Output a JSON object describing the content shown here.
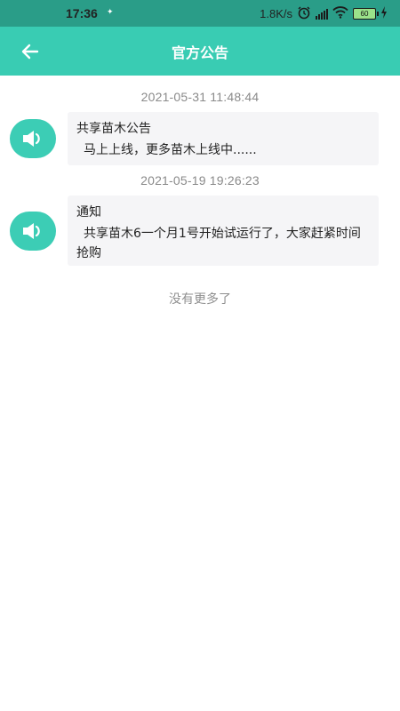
{
  "status_bar": {
    "time": "17:36",
    "network_speed": "1.8K/s",
    "battery_level": "60"
  },
  "header": {
    "title": "官方公告",
    "back_icon": "back-arrow-icon"
  },
  "notices": [
    {
      "timestamp": "2021-05-31 11:48:44",
      "title": "共享苗木公告",
      "body": "马上上线，更多苗木上线中......",
      "icon": "speaker-icon"
    },
    {
      "timestamp": "2021-05-19 19:26:23",
      "title": "通知",
      "body": "共享苗木6一个月1号开始试运行了，大家赶紧时间抢购",
      "icon": "speaker-icon"
    }
  ],
  "footer_text": "没有更多了",
  "colors": {
    "header_bg": "#39ccb3",
    "status_bg": "#2a9d88",
    "speaker_bg": "#3ccdb5",
    "bubble_bg": "#f5f5f7"
  }
}
